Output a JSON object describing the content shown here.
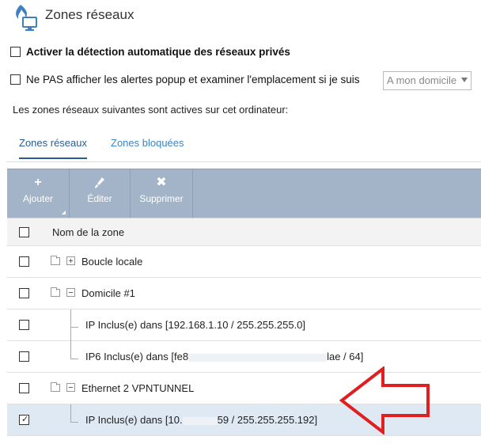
{
  "header": {
    "title": "Zones réseaux",
    "icon": "firewall-network-icon"
  },
  "options": {
    "auto_detect_label": "Activer la détection automatique des réseaux privés",
    "no_popup_label": "Ne PAS afficher les alertes popup et examiner l'emplacement si je suis",
    "location_select_value": "A mon domicile"
  },
  "info_text": "Les zones réseaux suivantes sont actives sur cet ordinateur:",
  "tabs": [
    {
      "label": "Zones réseaux",
      "active": true
    },
    {
      "label": "Zones bloquées",
      "active": false
    }
  ],
  "toolbar": {
    "add_label": "Ajouter",
    "edit_label": "Éditer",
    "delete_label": "Supprimer"
  },
  "table": {
    "column_header": "Nom de la zone",
    "rows": [
      {
        "label": "Boucle locale",
        "level": 0,
        "expanded": false,
        "checked": false
      },
      {
        "label": "Domicile #1",
        "level": 0,
        "expanded": true,
        "checked": false
      },
      {
        "label": "IP Inclus(e) dans [192.168.1.10 / 255.255.255.0]",
        "level": 1,
        "checked": false
      },
      {
        "label_start": "IP6 Inclus(e) dans [fe8",
        "label_end": "lae / 64]",
        "level": 1,
        "checked": false
      },
      {
        "label": "Ethernet 2 VPNTUNNEL",
        "level": 0,
        "expanded": true,
        "checked": false
      },
      {
        "label_start": "IP Inclus(e) dans [10.",
        "label_end": "59 / 255.255.255.192]",
        "level": 1,
        "checked": true,
        "selected": true
      }
    ]
  },
  "colors": {
    "toolbar_bg": "#a3b4c8",
    "tab_active": "#2a5d93",
    "tab_inactive": "#3b86c4",
    "selected_row": "#dfe9f4",
    "annotation_arrow": "#e02020"
  }
}
